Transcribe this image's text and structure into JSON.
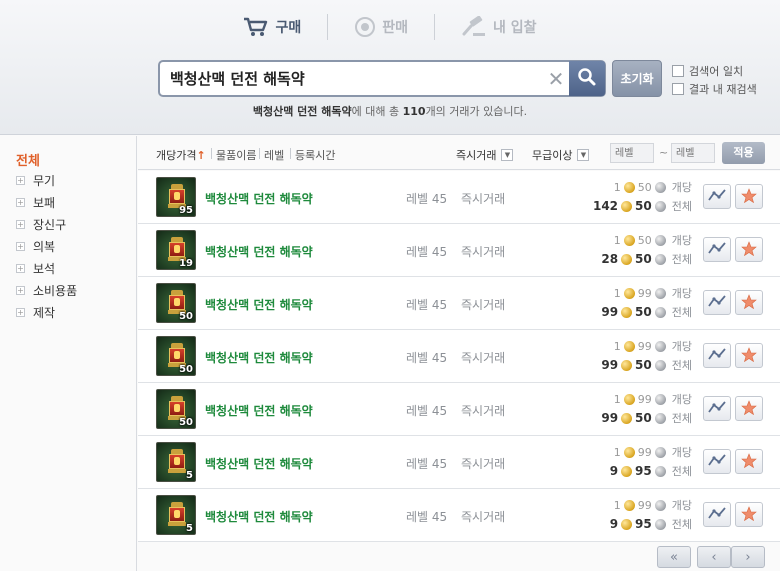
{
  "tabs": [
    {
      "label": "구매",
      "icon": "cart-icon",
      "active": true
    },
    {
      "label": "판매",
      "icon": "coin-icon",
      "active": false
    },
    {
      "label": "내 입찰",
      "icon": "gavel-icon",
      "active": false
    }
  ],
  "search": {
    "value": "백청산맥 던전 해독약",
    "clear_label": "✕",
    "reset_label": "초기화",
    "options": [
      "검색어 일치",
      "결과 내 재검색"
    ]
  },
  "result_message": {
    "query": "백청산맥 던전 해독약",
    "mid": "에 대해 총 ",
    "count": "110",
    "suffix": "개의 거래가 있습니다."
  },
  "sidebar": {
    "all_label": "전체",
    "items": [
      "무기",
      "보패",
      "장신구",
      "의복",
      "보석",
      "소비용품",
      "제작"
    ]
  },
  "header": {
    "sorts": [
      {
        "label": "개당가격",
        "active": true,
        "arrow": "↑"
      },
      {
        "label": "물품이름"
      },
      {
        "label": "레벨"
      },
      {
        "label": "등록시간"
      }
    ],
    "trade_filter": "즉시거래",
    "grade_filter": "무급이상",
    "level_min_placeholder": "레벨",
    "level_max_placeholder": "레벨",
    "tilde": "~",
    "apply_label": "적용",
    "dropdown_glyph": "▼"
  },
  "rows": [
    {
      "name": "백청산맥 던전 해독약",
      "qty": "95",
      "level": "레벨 45",
      "trade": "즉시거래",
      "unit_gold": "1",
      "unit_silver": "50",
      "total_gold": "142",
      "total_silver": "50"
    },
    {
      "name": "백청산맥 던전 해독약",
      "qty": "19",
      "level": "레벨 45",
      "trade": "즉시거래",
      "unit_gold": "1",
      "unit_silver": "50",
      "total_gold": "28",
      "total_silver": "50"
    },
    {
      "name": "백청산맥 던전 해독약",
      "qty": "50",
      "level": "레벨 45",
      "trade": "즉시거래",
      "unit_gold": "1",
      "unit_silver": "99",
      "total_gold": "99",
      "total_silver": "50"
    },
    {
      "name": "백청산맥 던전 해독약",
      "qty": "50",
      "level": "레벨 45",
      "trade": "즉시거래",
      "unit_gold": "1",
      "unit_silver": "99",
      "total_gold": "99",
      "total_silver": "50"
    },
    {
      "name": "백청산맥 던전 해독약",
      "qty": "50",
      "level": "레벨 45",
      "trade": "즉시거래",
      "unit_gold": "1",
      "unit_silver": "99",
      "total_gold": "99",
      "total_silver": "50"
    },
    {
      "name": "백청산맥 던전 해독약",
      "qty": "5",
      "level": "레벨 45",
      "trade": "즉시거래",
      "unit_gold": "1",
      "unit_silver": "99",
      "total_gold": "9",
      "total_silver": "95"
    },
    {
      "name": "백청산맥 던전 해독약",
      "qty": "5",
      "level": "레벨 45",
      "trade": "즉시거래",
      "unit_gold": "1",
      "unit_silver": "99",
      "total_gold": "9",
      "total_silver": "95"
    }
  ],
  "price_labels": {
    "unit": "개당",
    "total": "전체"
  },
  "pager": {
    "first": "«",
    "prev": "‹",
    "next": "›"
  },
  "colors": {
    "accent": "#e0602a",
    "item_name": "#1e8a3c",
    "header_blue": "#4a5a72"
  }
}
